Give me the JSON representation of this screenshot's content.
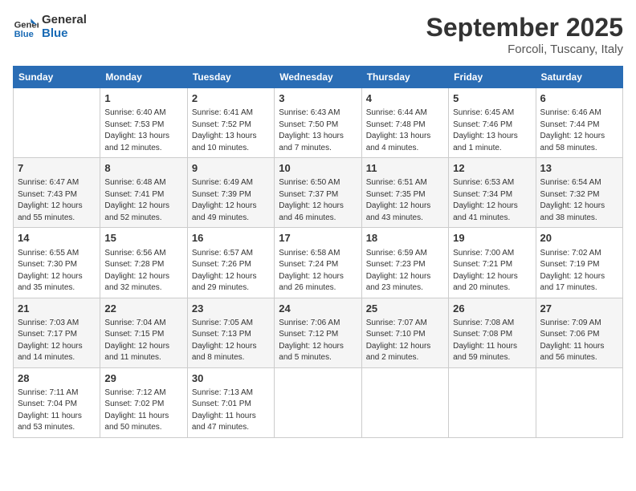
{
  "logo": {
    "text_general": "General",
    "text_blue": "Blue"
  },
  "title": "September 2025",
  "location": "Forcoli, Tuscany, Italy",
  "days_of_week": [
    "Sunday",
    "Monday",
    "Tuesday",
    "Wednesday",
    "Thursday",
    "Friday",
    "Saturday"
  ],
  "weeks": [
    [
      {
        "day": "",
        "info": ""
      },
      {
        "day": "1",
        "info": "Sunrise: 6:40 AM\nSunset: 7:53 PM\nDaylight: 13 hours\nand 12 minutes."
      },
      {
        "day": "2",
        "info": "Sunrise: 6:41 AM\nSunset: 7:52 PM\nDaylight: 13 hours\nand 10 minutes."
      },
      {
        "day": "3",
        "info": "Sunrise: 6:43 AM\nSunset: 7:50 PM\nDaylight: 13 hours\nand 7 minutes."
      },
      {
        "day": "4",
        "info": "Sunrise: 6:44 AM\nSunset: 7:48 PM\nDaylight: 13 hours\nand 4 minutes."
      },
      {
        "day": "5",
        "info": "Sunrise: 6:45 AM\nSunset: 7:46 PM\nDaylight: 13 hours\nand 1 minute."
      },
      {
        "day": "6",
        "info": "Sunrise: 6:46 AM\nSunset: 7:44 PM\nDaylight: 12 hours\nand 58 minutes."
      }
    ],
    [
      {
        "day": "7",
        "info": "Sunrise: 6:47 AM\nSunset: 7:43 PM\nDaylight: 12 hours\nand 55 minutes."
      },
      {
        "day": "8",
        "info": "Sunrise: 6:48 AM\nSunset: 7:41 PM\nDaylight: 12 hours\nand 52 minutes."
      },
      {
        "day": "9",
        "info": "Sunrise: 6:49 AM\nSunset: 7:39 PM\nDaylight: 12 hours\nand 49 minutes."
      },
      {
        "day": "10",
        "info": "Sunrise: 6:50 AM\nSunset: 7:37 PM\nDaylight: 12 hours\nand 46 minutes."
      },
      {
        "day": "11",
        "info": "Sunrise: 6:51 AM\nSunset: 7:35 PM\nDaylight: 12 hours\nand 43 minutes."
      },
      {
        "day": "12",
        "info": "Sunrise: 6:53 AM\nSunset: 7:34 PM\nDaylight: 12 hours\nand 41 minutes."
      },
      {
        "day": "13",
        "info": "Sunrise: 6:54 AM\nSunset: 7:32 PM\nDaylight: 12 hours\nand 38 minutes."
      }
    ],
    [
      {
        "day": "14",
        "info": "Sunrise: 6:55 AM\nSunset: 7:30 PM\nDaylight: 12 hours\nand 35 minutes."
      },
      {
        "day": "15",
        "info": "Sunrise: 6:56 AM\nSunset: 7:28 PM\nDaylight: 12 hours\nand 32 minutes."
      },
      {
        "day": "16",
        "info": "Sunrise: 6:57 AM\nSunset: 7:26 PM\nDaylight: 12 hours\nand 29 minutes."
      },
      {
        "day": "17",
        "info": "Sunrise: 6:58 AM\nSunset: 7:24 PM\nDaylight: 12 hours\nand 26 minutes."
      },
      {
        "day": "18",
        "info": "Sunrise: 6:59 AM\nSunset: 7:23 PM\nDaylight: 12 hours\nand 23 minutes."
      },
      {
        "day": "19",
        "info": "Sunrise: 7:00 AM\nSunset: 7:21 PM\nDaylight: 12 hours\nand 20 minutes."
      },
      {
        "day": "20",
        "info": "Sunrise: 7:02 AM\nSunset: 7:19 PM\nDaylight: 12 hours\nand 17 minutes."
      }
    ],
    [
      {
        "day": "21",
        "info": "Sunrise: 7:03 AM\nSunset: 7:17 PM\nDaylight: 12 hours\nand 14 minutes."
      },
      {
        "day": "22",
        "info": "Sunrise: 7:04 AM\nSunset: 7:15 PM\nDaylight: 12 hours\nand 11 minutes."
      },
      {
        "day": "23",
        "info": "Sunrise: 7:05 AM\nSunset: 7:13 PM\nDaylight: 12 hours\nand 8 minutes."
      },
      {
        "day": "24",
        "info": "Sunrise: 7:06 AM\nSunset: 7:12 PM\nDaylight: 12 hours\nand 5 minutes."
      },
      {
        "day": "25",
        "info": "Sunrise: 7:07 AM\nSunset: 7:10 PM\nDaylight: 12 hours\nand 2 minutes."
      },
      {
        "day": "26",
        "info": "Sunrise: 7:08 AM\nSunset: 7:08 PM\nDaylight: 11 hours\nand 59 minutes."
      },
      {
        "day": "27",
        "info": "Sunrise: 7:09 AM\nSunset: 7:06 PM\nDaylight: 11 hours\nand 56 minutes."
      }
    ],
    [
      {
        "day": "28",
        "info": "Sunrise: 7:11 AM\nSunset: 7:04 PM\nDaylight: 11 hours\nand 53 minutes."
      },
      {
        "day": "29",
        "info": "Sunrise: 7:12 AM\nSunset: 7:02 PM\nDaylight: 11 hours\nand 50 minutes."
      },
      {
        "day": "30",
        "info": "Sunrise: 7:13 AM\nSunset: 7:01 PM\nDaylight: 11 hours\nand 47 minutes."
      },
      {
        "day": "",
        "info": ""
      },
      {
        "day": "",
        "info": ""
      },
      {
        "day": "",
        "info": ""
      },
      {
        "day": "",
        "info": ""
      }
    ]
  ]
}
